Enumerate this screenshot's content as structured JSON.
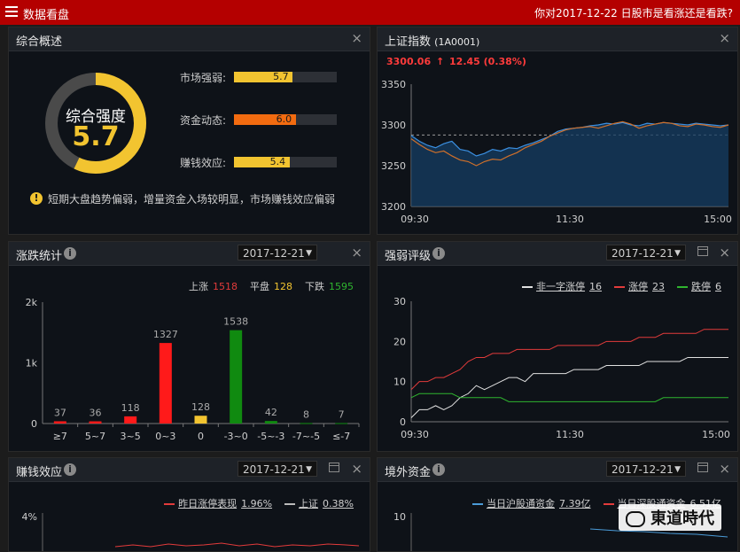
{
  "topbar": {
    "title": "数据看盘",
    "question": "你对2017-12-22 日股市是看涨还是看跌?"
  },
  "overview": {
    "title": "综合概述",
    "gauge_label": "综合强度",
    "gauge_value": "5.7",
    "gauge_fraction": 0.57,
    "metrics": [
      {
        "label": "市场强弱:",
        "value": "5.7",
        "fraction": 0.57,
        "color": "#f2c430"
      },
      {
        "label": "资金动态:",
        "value": "6.0",
        "fraction": 0.6,
        "color": "#f26b10"
      },
      {
        "label": "赚钱效应:",
        "value": "5.4",
        "fraction": 0.54,
        "color": "#f2c430"
      }
    ],
    "note": "短期大盘趋势偏弱，增量资金入场较明显，市场赚钱效应偏弱"
  },
  "index": {
    "title": "上证指数",
    "code": "(1A0001)",
    "price": "3300.06",
    "change": "12.45",
    "pct": "(0.38%)",
    "y_ticks": [
      "3350",
      "3300",
      "3250",
      "3200"
    ],
    "x_ticks": [
      "09:30",
      "11:30",
      "15:00"
    ]
  },
  "updown": {
    "title": "涨跌统计",
    "date": "2017-12-21",
    "legend": [
      {
        "label": "上涨",
        "value": "1518",
        "color": "#e23b3b"
      },
      {
        "label": "平盘",
        "value": "128",
        "color": "#f2c430"
      },
      {
        "label": "下跌",
        "value": "1595",
        "color": "#2fb52f"
      }
    ],
    "y_ticks": [
      "2k",
      "1k",
      "0"
    ]
  },
  "strength": {
    "title": "强弱评级",
    "date": "2017-12-21",
    "legend": [
      {
        "label": "非一字涨停",
        "value": "16",
        "color": "#e0e0e0"
      },
      {
        "label": "涨停",
        "value": "23",
        "color": "#e23b3b"
      },
      {
        "label": "跌停",
        "value": "6",
        "color": "#2fb52f"
      }
    ],
    "y_ticks": [
      "30",
      "20",
      "10",
      "0"
    ],
    "x_ticks": [
      "09:30",
      "11:30",
      "15:00"
    ]
  },
  "profit": {
    "title": "赚钱效应",
    "date": "2017-12-21",
    "legend": [
      {
        "label": "昨日涨停表现",
        "value": "1.96%",
        "color": "#e23b3b"
      },
      {
        "label": "上证",
        "value": "0.38%",
        "color": "#bbbbbb"
      }
    ],
    "y_tick": "4%"
  },
  "foreign": {
    "title": "境外资金",
    "date": "2017-12-21",
    "legend": [
      {
        "label": "当日沪股通资金",
        "value": "7.39亿",
        "color": "#4a9bd8"
      },
      {
        "label": "当日深股通资金",
        "value": "6.51亿",
        "color": "#e23b3b"
      }
    ],
    "y_tick": "10"
  },
  "watermark": "東道時代",
  "chart_data": [
    {
      "type": "bar",
      "title": "涨跌统计",
      "categories": [
        "≥7",
        "5~7",
        "3~5",
        "0~3",
        "0",
        "-3~0",
        "-5~-3",
        "-7~-5",
        "≤-7"
      ],
      "values": [
        37,
        36,
        118,
        1327,
        128,
        1538,
        42,
        8,
        7
      ],
      "colors": [
        "#ff1a1a",
        "#ff1a1a",
        "#ff1a1a",
        "#ff1a1a",
        "#f2c430",
        "#108a10",
        "#108a10",
        "#108a10",
        "#108a10"
      ],
      "ylim": [
        0,
        2000
      ]
    },
    {
      "type": "line",
      "title": "上证指数",
      "ylim": [
        3200,
        3350
      ],
      "reference": 3287.6,
      "series": [
        {
          "values": [
            3287,
            3280,
            3275,
            3272,
            3277,
            3280,
            3270,
            3268,
            3262,
            3265,
            3270,
            3268,
            3272,
            3271,
            3275,
            3278,
            3282,
            3286,
            3292,
            3295,
            3296,
            3297,
            3299,
            3300,
            3302,
            3301,
            3303,
            3300,
            3299,
            3302,
            3301,
            3303,
            3302,
            3301,
            3300,
            3302,
            3301,
            3300,
            3299,
            3300
          ]
        },
        {
          "values": [
            3283,
            3276,
            3270,
            3266,
            3268,
            3262,
            3257,
            3255,
            3250,
            3255,
            3258,
            3257,
            3262,
            3266,
            3272,
            3276,
            3280,
            3286,
            3290,
            3294,
            3296,
            3297,
            3298,
            3296,
            3299,
            3302,
            3304,
            3301,
            3296,
            3299,
            3301,
            3303,
            3302,
            3299,
            3298,
            3301,
            3300,
            3298,
            3297,
            3300
          ]
        }
      ]
    },
    {
      "type": "line",
      "title": "强弱评级",
      "ylim": [
        0,
        30
      ],
      "series": [
        {
          "name": "非一字涨停",
          "values": [
            1,
            3,
            3,
            4,
            3,
            4,
            6,
            7,
            9,
            8,
            9,
            10,
            11,
            11,
            10,
            12,
            12,
            12,
            12,
            12,
            13,
            13,
            13,
            13,
            14,
            14,
            14,
            14,
            14,
            15,
            15,
            15,
            15,
            15,
            16,
            16,
            16,
            16,
            16,
            16
          ]
        },
        {
          "name": "涨停",
          "values": [
            8,
            10,
            10,
            11,
            11,
            12,
            13,
            15,
            16,
            16,
            17,
            17,
            17,
            18,
            18,
            18,
            18,
            18,
            19,
            19,
            19,
            19,
            19,
            19,
            20,
            20,
            20,
            20,
            21,
            21,
            21,
            22,
            22,
            22,
            22,
            22,
            23,
            23,
            23,
            23
          ]
        },
        {
          "name": "跌停",
          "values": [
            6,
            7,
            7,
            7,
            7,
            7,
            6,
            6,
            6,
            6,
            6,
            6,
            5,
            5,
            5,
            5,
            5,
            5,
            5,
            5,
            5,
            5,
            5,
            5,
            5,
            5,
            5,
            5,
            5,
            5,
            5,
            6,
            6,
            6,
            6,
            6,
            6,
            6,
            6,
            6
          ]
        }
      ]
    }
  ]
}
